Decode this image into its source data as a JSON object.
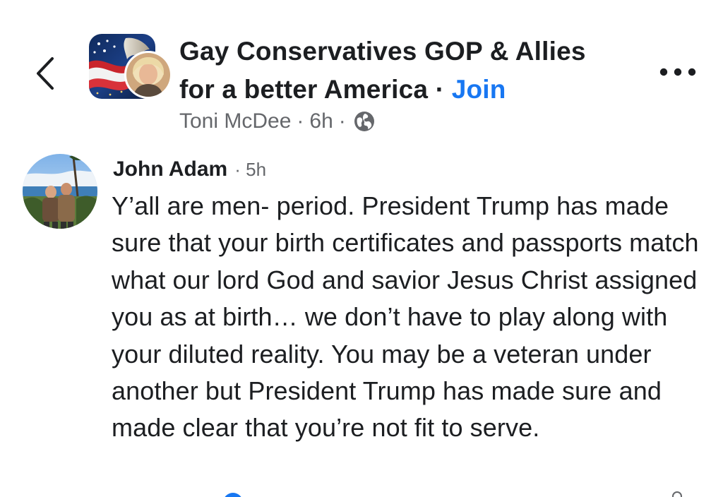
{
  "header": {
    "back_icon": "chevron-left-icon",
    "group_title_line1": "Gay Conservatives GOP & Allies",
    "group_title_line2": "for a better America",
    "separator": "·",
    "join_label": "Join",
    "more_icon": "more-horizontal-icon",
    "author": "Toni McDee",
    "time": "6h",
    "audience_icon": "globe-icon"
  },
  "comment": {
    "author": "John Adam",
    "separator": "·",
    "time": "5h",
    "text": "Y’all are men- period. President Trump has made sure that your birth certificates and passports match what our lord God and savior Jesus Christ assigned you as at birth… we don’t have to play along with your diluted reality. You may be a veteran under another but President Trump has made sure and made clear that you’re not fit to serve."
  },
  "colors": {
    "text_primary": "#1c1e21",
    "text_secondary": "#65676b",
    "link_blue": "#1877f2"
  }
}
